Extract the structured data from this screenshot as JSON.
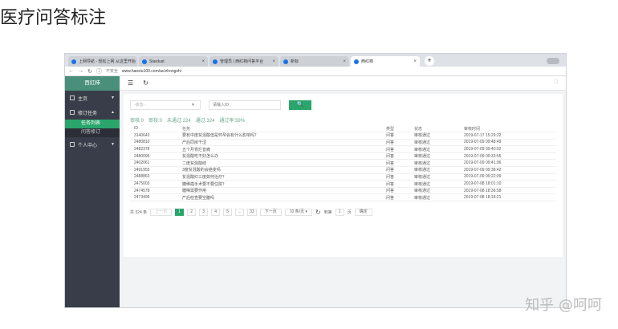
{
  "page_title": "医疗问答标注",
  "watermark": "知乎 @呵呵",
  "browser": {
    "tabs": [
      {
        "label": "上网导航 - 轻松上网 从这里开始"
      },
      {
        "label": "Stardust"
      },
      {
        "label": "管理员 | 西红柿问答平台"
      },
      {
        "label": "新标"
      },
      {
        "label": "西红柿"
      }
    ],
    "new_tab": "+",
    "insecure": "不安全",
    "url": "www.haoxiu100.com/ac/zhongshi"
  },
  "sidebar": {
    "brand": "西红柿",
    "groups": [
      {
        "label": "主页",
        "arrow": "▼"
      },
      {
        "label": "修订任务",
        "arrow": "▲"
      }
    ],
    "subitems": [
      {
        "label": "任务列表"
      },
      {
        "label": "问答修订"
      }
    ],
    "personal": {
      "label": "个人中心",
      "arrow": "▼"
    }
  },
  "topbar": {
    "menu_icon": "☰",
    "refresh_icon": "↻",
    "expand_icon": "⛶"
  },
  "filters": {
    "status_placeholder": "-状态-",
    "text_placeholder": "请输入ID",
    "search_icon": "🔍"
  },
  "stats": {
    "pending": "审核:0",
    "reviewing": "审核:0",
    "rejected": "未通过:224",
    "passed": "通过:324",
    "rate": "通过率:59%"
  },
  "table": {
    "headers": [
      "ID",
      "任务",
      "类型",
      "状态",
      "审核时间"
    ],
    "rows": [
      [
        "3140643",
        "要有中度贫混酸但是怀孕会有什么影响吗？",
        "问答",
        "审核通过",
        "2019-07-17 15:29:22"
      ],
      [
        "2480810",
        "产后同房干涩",
        "问答",
        "审核通过",
        "2019-07-09 09:48:49"
      ],
      [
        "2482378",
        "五个月胃烂音痛",
        "问答",
        "审核通过",
        "2019-07-09 09:40:02"
      ],
      [
        "2480095",
        "贫混酸吃不好怎么办",
        "问答",
        "审核通过",
        "2019-07-09 09:33:55"
      ],
      [
        "2402061",
        "二度贫混酸结",
        "问答",
        "审核通过",
        "2019-07-09 09:41:06"
      ],
      [
        "2491955",
        "3度贫混酸的会癌变吗",
        "问答",
        "审核通过",
        "2019-07-09 09:38:42"
      ],
      [
        "2488863",
        "贫混酸红三度如何治疗？",
        "问答",
        "审核通过",
        "2019-07-09 09:22:09"
      ],
      [
        "2475003",
        "糖稀癌手术要不要住院？",
        "问答",
        "审核通过",
        "2019-07-08 18:01:10"
      ],
      [
        "2474578",
        "糖稀需要作用",
        "问答",
        "审核通过",
        "2019-07-08 18:36:58"
      ],
      [
        "2473499",
        "产后检查要空腹吗",
        "问答",
        "审核通过",
        "2019-07-08 18:18:21"
      ]
    ]
  },
  "pager": {
    "total": "共 324 条",
    "prev": "上一页",
    "pages": [
      "1",
      "2",
      "3",
      "4",
      "5",
      "...",
      "33"
    ],
    "next": "下一页",
    "per_page": "10 条/页 ▾",
    "goto_label": "到第",
    "goto_value": "1",
    "page_unit": "页",
    "confirm": "确定"
  }
}
